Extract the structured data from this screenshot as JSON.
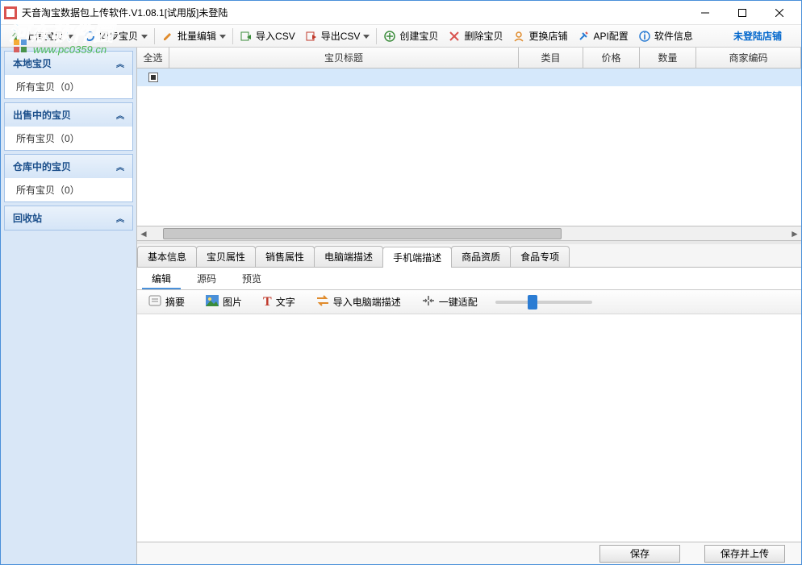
{
  "window": {
    "title": "天音淘宝数据包上传软件.V1.08.1[试用版]未登陆"
  },
  "toolbar": {
    "upload": "上传宝贝",
    "sync": "同步宝贝",
    "batchEdit": "批量编辑",
    "importCsv": "导入CSV",
    "exportCsv": "导出CSV",
    "create": "创建宝贝",
    "delete": "删除宝贝",
    "switchShop": "更换店铺",
    "apiConfig": "API配置",
    "softInfo": "软件信息",
    "loginStatus": "未登陆店铺"
  },
  "sidebar": {
    "groups": [
      {
        "title": "本地宝贝",
        "items": [
          "所有宝贝（0）"
        ]
      },
      {
        "title": "出售中的宝贝",
        "items": [
          "所有宝贝（0）"
        ]
      },
      {
        "title": "仓库中的宝贝",
        "items": [
          "所有宝贝（0）"
        ]
      },
      {
        "title": "回收站",
        "items": []
      }
    ]
  },
  "grid": {
    "headers": {
      "check": "全选",
      "title": "宝贝标题",
      "category": "类目",
      "price": "价格",
      "qty": "数量",
      "code": "商家编码"
    }
  },
  "detailTabs": [
    "基本信息",
    "宝贝属性",
    "销售属性",
    "电脑端描述",
    "手机端描述",
    "商品资质",
    "食品专项"
  ],
  "detailActiveTab": 4,
  "subTabs": [
    "编辑",
    "源码",
    "预览"
  ],
  "subActiveTab": 0,
  "editToolbar": {
    "summary": "摘要",
    "image": "图片",
    "text": "文字",
    "importPc": "导入电脑端描述",
    "autofit": "一键适配"
  },
  "footer": {
    "save": "保存",
    "saveUpload": "保存并上传"
  },
  "watermark": {
    "line1": "河东软件园",
    "line2": "www.pc0359.cn"
  }
}
